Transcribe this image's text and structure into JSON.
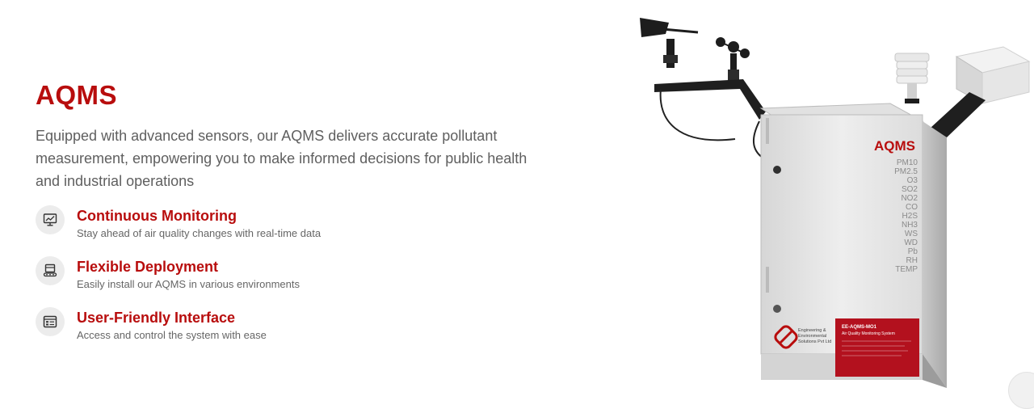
{
  "section": {
    "title": "AQMS",
    "description": "Equipped with advanced sensors, our AQMS delivers accurate pollutant measurement, empowering you to make informed decisions for public health and industrial operations"
  },
  "features": [
    {
      "icon": "monitor-chart-icon",
      "title": "Continuous Monitoring",
      "subtitle": "Stay ahead of air quality changes with real-time data"
    },
    {
      "icon": "deployment-device-icon",
      "title": "Flexible Deployment",
      "subtitle": "Easily install our AQMS in various environments"
    },
    {
      "icon": "interface-panel-icon",
      "title": "User-Friendly Interface",
      "subtitle": "Access and control the system with ease"
    }
  ],
  "product": {
    "panel_brand": "AQMS",
    "parameters": [
      "PM10",
      "PM2.5",
      "O3",
      "SO2",
      "NO2",
      "CO",
      "H2S",
      "NH3",
      "WS",
      "WD",
      "Pb",
      "RH",
      "TEMP"
    ],
    "company_name_line1": "Engineering &",
    "company_name_line2": "Environmental",
    "company_name_line3": "Solutions Pvt Ltd",
    "label_title": "EE-AQMS-MO1",
    "label_subtitle": "Air Quality Monitoring System"
  },
  "colors": {
    "accent": "#b80d0d",
    "text": "#5f5f5f",
    "icon_bg": "#ececec"
  }
}
